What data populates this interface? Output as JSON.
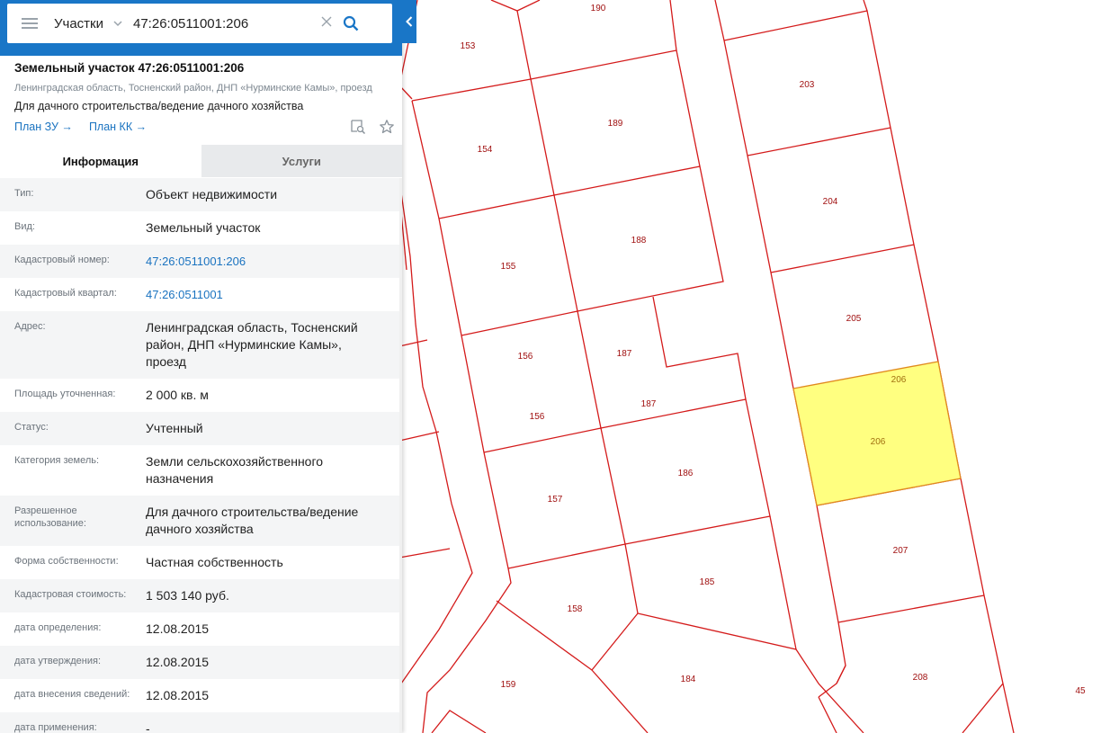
{
  "search": {
    "type_label": "Участки",
    "query": "47:26:0511001:206"
  },
  "object": {
    "title": "Земельный участок 47:26:0511001:206",
    "address_short": "Ленинградская область, Тосненский район, ДНП «Нурминские Камы», проезд",
    "purpose": "Для дачного строительства/ведение дачного хозяйства",
    "link_plan_zu": "План ЗУ →",
    "link_plan_kk": "План КК →"
  },
  "tabs": [
    {
      "label": "Информация",
      "active": true
    },
    {
      "label": "Услуги",
      "active": false
    }
  ],
  "fields": [
    {
      "label": "Тип:",
      "value": "Объект недвижимости"
    },
    {
      "label": "Вид:",
      "value": "Земельный участок"
    },
    {
      "label": "Кадастровый номер:",
      "value": "47:26:0511001:206",
      "link": true
    },
    {
      "label": "Кадастровый квартал:",
      "value": "47:26:0511001",
      "link": true
    },
    {
      "label": "Адрес:",
      "value": "Ленинградская область, Тосненский район, ДНП «Нурминские Камы», проезд"
    },
    {
      "label": "Площадь уточненная:",
      "value": "2 000 кв. м"
    },
    {
      "label": "Статус:",
      "value": "Учтенный"
    },
    {
      "label": "Категория земель:",
      "value": "Земли сельскохозяйственного назначения"
    },
    {
      "label": "Разрешенное использование:",
      "value": "Для дачного строительства/ведение дачного хозяйства"
    },
    {
      "label": "Форма собственности:",
      "value": "Частная собственность"
    },
    {
      "label": "Кадастровая стоимость:",
      "value": "1 503 140 руб."
    },
    {
      "label": "дата определения:",
      "value": "12.08.2015"
    },
    {
      "label": "дата утверждения:",
      "value": "12.08.2015"
    },
    {
      "label": "дата внесения сведений:",
      "value": "12.08.2015"
    },
    {
      "label": "дата применения:",
      "value": "-"
    }
  ],
  "map": {
    "parcel_labels": [
      "190",
      "153",
      "203",
      "189",
      "154",
      "204",
      "188",
      "155",
      "205",
      "156",
      "187",
      "187",
      "206",
      "206",
      "156",
      "157",
      "186",
      "207",
      "158",
      "185",
      "159",
      "184",
      "208",
      "45"
    ],
    "selected_parcel": "206",
    "colors": {
      "boundary": "#d41b1b",
      "label": "#a01010",
      "selected_fill": "#ffff80",
      "selected_stroke": "#e08a1e",
      "selected_label": "#a07010",
      "header": "#1976c7",
      "link": "#1a73c0"
    }
  }
}
